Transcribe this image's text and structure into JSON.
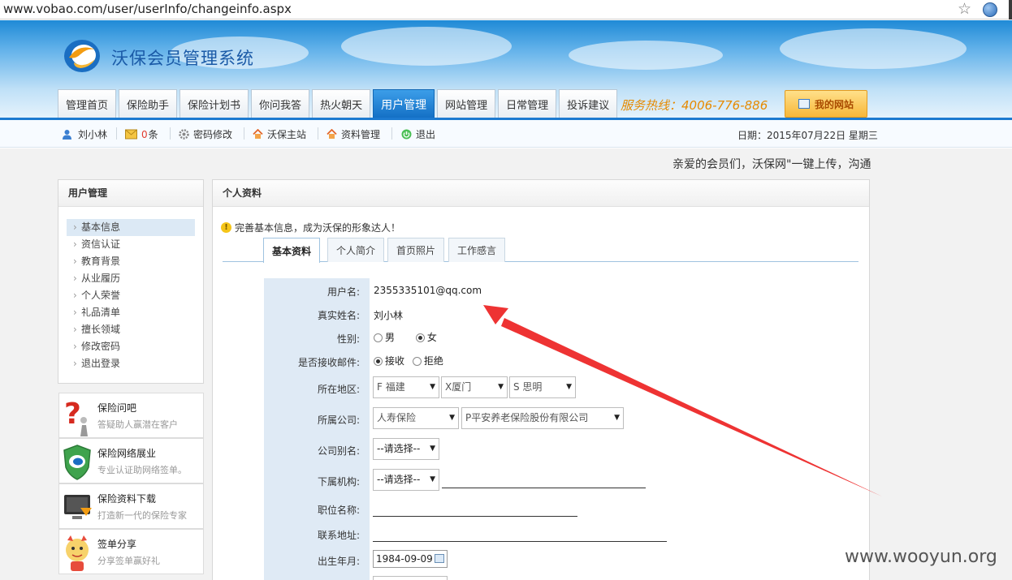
{
  "browser": {
    "url": "www.vobao.com/user/userInfo/changeinfo.aspx"
  },
  "site": {
    "logo_text": "沃保会员管理系统",
    "hotline": "服务热线：4006-776-886",
    "my_site": "我的网站",
    "nav": [
      "管理首页",
      "保险助手",
      "保险计划书",
      "你问我答",
      "热火朝天",
      "用户管理",
      "网站管理",
      "日常管理",
      "投诉建议"
    ],
    "nav_active": "用户管理"
  },
  "infobar": {
    "user": "刘小林",
    "msg_count": "0",
    "msg_unit": "条",
    "links": [
      "密码修改",
      "沃保主站",
      "资料管理",
      "退出"
    ],
    "date": "日期：2015年07月22日 星期三"
  },
  "marquee": "亲爱的会员们，沃保网\"一键上传，沟通",
  "sidebar": {
    "title": "用户管理",
    "items": [
      "基本信息",
      "资信认证",
      "教育背景",
      "从业履历",
      "个人荣誉",
      "礼品清单",
      "擅长领域",
      "修改密码",
      "退出登录"
    ],
    "active": "基本信息"
  },
  "promos": [
    {
      "title": "保险问吧",
      "desc": "答疑助人赢潜在客户"
    },
    {
      "title": "保险网络展业",
      "desc": "专业认证助网络签单。"
    },
    {
      "title": "保险资料下载",
      "desc": "打造新一代的保险专家"
    },
    {
      "title": "签单分享",
      "desc": "分享签单赢好礼"
    }
  ],
  "main": {
    "title": "个人资料",
    "notice": "完善基本信息，成为沃保的形象达人！",
    "tabs": [
      "基本资料",
      "个人简介",
      "首页照片",
      "工作感言"
    ],
    "tab_active": "基本资料"
  },
  "form": {
    "username_label": "用户名:",
    "username": "2355335101@qq.com",
    "realname_label": "真实姓名:",
    "realname": "刘小林",
    "gender_label": "性别:",
    "gender_male": "男",
    "gender_female": "女",
    "gender_selected": "女",
    "email_label": "是否接收邮件:",
    "email_yes": "接收",
    "email_no": "拒绝",
    "email_selected": "接收",
    "region_label": "所在地区:",
    "province": "F 福建",
    "city": "X厦门",
    "district": "S 思明",
    "company_label": "所属公司:",
    "company_type": "人寿保险",
    "company": "P平安养老保险股份有限公司",
    "alias_label": "公司别名:",
    "alias": "--请选择--",
    "branch_label": "下属机构:",
    "branch": "--请选择--",
    "position_label": "职位名称:",
    "address_label": "联系地址:",
    "birth_label": "出生年月:",
    "birth": "1984-09-09"
  },
  "watermark": "www.wooyun.org",
  "colors": {
    "accent": "#1c7ad0",
    "hotline": "#e68a00",
    "arrow": "#ee3333"
  }
}
